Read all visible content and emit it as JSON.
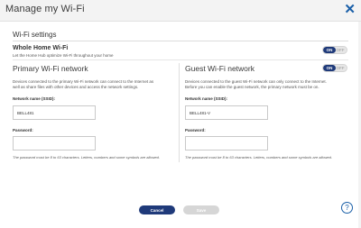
{
  "dialog": {
    "title": "Manage my Wi-Fi",
    "close_icon": "close-icon",
    "close_glyph": "✕"
  },
  "wifi_settings": {
    "title": "Wi-Fi settings",
    "whole_home": {
      "title": "Whole Home Wi-Fi",
      "description": "Let the Home Hub optimize Wi-Fi throughout your home",
      "toggle_on": "ON",
      "toggle_off": "OFF",
      "state": "on"
    }
  },
  "primary": {
    "title": "Primary Wi-Fi network",
    "description": "Devices connected to the primary Wi-Fi network can connect to the Internet as well as share files with other devices and access the network settings.",
    "ssid_label": "Network name (SSID):",
    "ssid_value": "BELL481",
    "password_label": "Password:",
    "password_value": "",
    "hint": "The password must be 8 to 63 characters. Letters, numbers and some symbols are allowed."
  },
  "guest": {
    "title": "Guest Wi-Fi network",
    "description": "Devices connected to the guest Wi-Fi network can only connect to the Internet. Before you can enable the guest network, the primary network must be on.",
    "ssid_label": "Network name (SSID):",
    "ssid_value": "BELL481-V",
    "password_label": "Password:",
    "password_value": "",
    "hint": "The password must be 8 to 63 characters. Letters, numbers and some symbols are allowed.",
    "toggle_on": "ON",
    "toggle_off": "OFF",
    "state": "on"
  },
  "footer": {
    "cancel_label": "Cancel",
    "save_label": "Save",
    "help_glyph": "?"
  },
  "colors": {
    "accent": "#1f3a7a",
    "link": "#1a5fa8",
    "disabled": "#d6d6d6"
  }
}
